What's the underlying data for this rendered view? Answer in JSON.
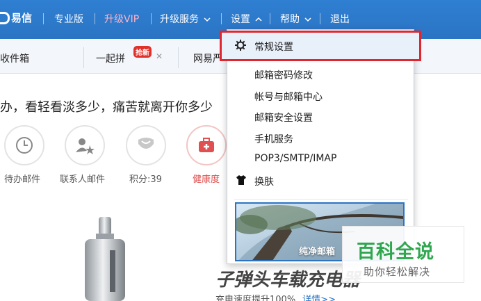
{
  "topbar": {
    "brand": "易信",
    "pro": "专业版",
    "vip": "升级VIP",
    "upgrade": "升级服务",
    "settings": "设置",
    "help": "帮助",
    "logout": "退出"
  },
  "tabs": {
    "inbox": "收件箱",
    "pin": "一起拼",
    "pin_badge": "抢新",
    "wy": "网易严"
  },
  "main": {
    "quote": "办，看轻看淡多少，痛苦就离开你多少",
    "shortcuts": [
      {
        "label": "待办邮件"
      },
      {
        "label": "联系人邮件"
      },
      {
        "label": "积分:39"
      },
      {
        "label": "健康度"
      }
    ],
    "ad_title": "子弹头车载充电器",
    "ad_sub": "充电速度提升100%",
    "ad_more": "详情>>"
  },
  "dropdown": {
    "items": [
      "常规设置",
      "邮箱密码修改",
      "帐号与邮箱中心",
      "邮箱安全设置",
      "手机服务",
      "POP3/SMTP/IMAP",
      "换肤"
    ],
    "skin_caption": "纯净邮箱"
  },
  "watermark": {
    "title": "百科全说",
    "sub": "助你轻松解决"
  },
  "colors": {
    "topbar": "#2f7fd2",
    "highlight_border": "#e0262e",
    "health": "#e05050"
  }
}
